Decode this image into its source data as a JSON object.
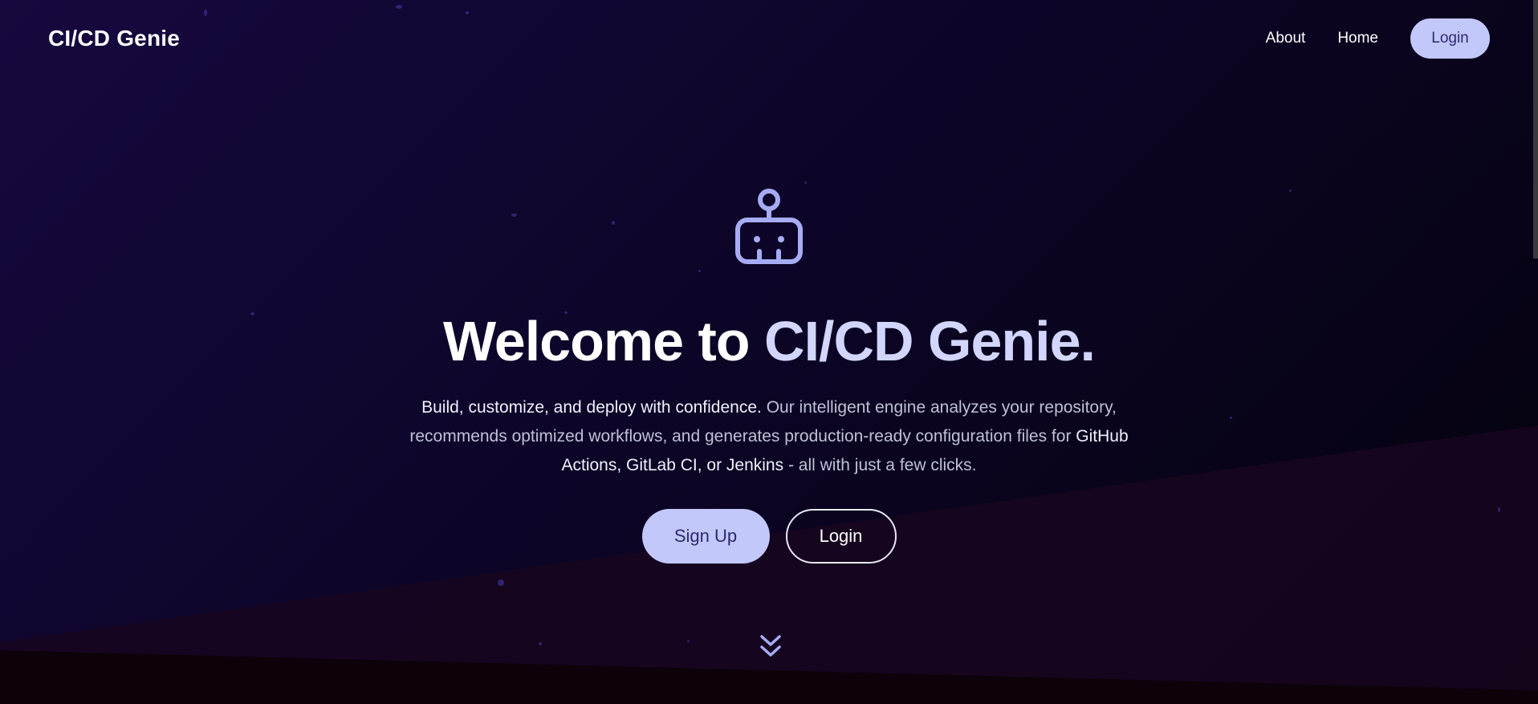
{
  "nav": {
    "brand": "CI/CD Genie",
    "about": "About",
    "home": "Home",
    "login": "Login"
  },
  "hero": {
    "icon": "robot-icon",
    "title_part1": "Welcome to ",
    "title_part2": "CI/CD Genie.",
    "desc_strong1": "Build, customize, and deploy with confidence.",
    "desc_text1": " Our intelligent engine analyzes your repository, recommends optimized workflows, and generates production-ready configuration files for ",
    "desc_strong2": "GitHub Actions, GitLab CI, or Jenkins",
    "desc_text2": " - all with just a few clicks.",
    "signup_label": "Sign Up",
    "login_label": "Login",
    "scroll_icon": "double-chevron-down-icon"
  },
  "colors": {
    "accent": "#c3c8fb",
    "accent_text": "#2c2a6d",
    "icon": "#a6acf4",
    "background_dark": "#0d0528"
  }
}
